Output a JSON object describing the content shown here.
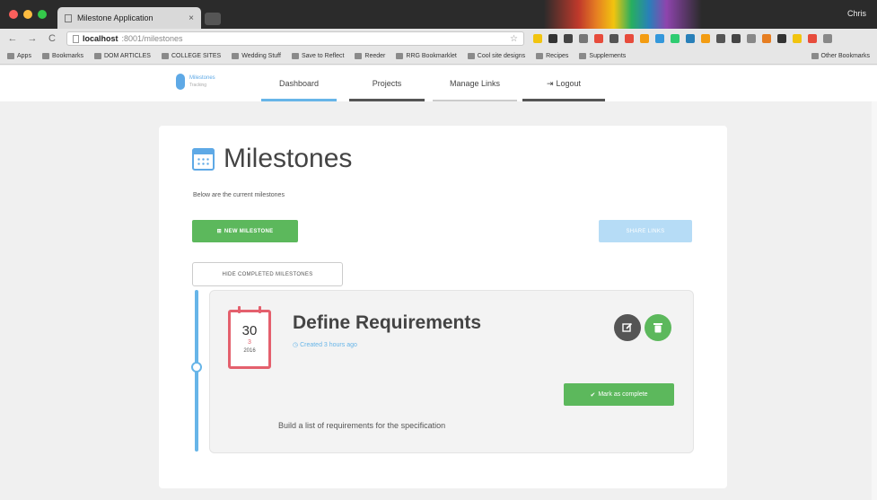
{
  "browser": {
    "tab_title": "Milestone Application",
    "tab_close": "×",
    "user_name": "Chris",
    "nav_back": "←",
    "nav_forward": "→",
    "nav_reload": "C",
    "url_host": "localhost",
    "url_path": ":8001/milestones",
    "star": "☆",
    "extensions_colors": [
      "#f1c40f",
      "#333333",
      "#444444",
      "#777777",
      "#e74c3c",
      "#555555",
      "#e74c3c",
      "#f39c12",
      "#3498db",
      "#2ecc71",
      "#2980b9",
      "#f39c12",
      "#555555",
      "#444444",
      "#888888",
      "#e67e22",
      "#333333",
      "#f1c40f",
      "#e74c3c",
      "#888888"
    ],
    "bookmarks": [
      "Apps",
      "Bookmarks",
      "DOM ARTICLES",
      "COLLEGE SITES",
      "Wedding Stuff",
      "Save to Reflect",
      "Reeder",
      "RRG Bookmarklet",
      "Cool site designs",
      "Recipes",
      "Supplements"
    ],
    "bookmarks_right": "Other Bookmarks"
  },
  "app_nav": {
    "brand_name": "Milestones",
    "brand_sub": "Tracking",
    "items": [
      "Dashboard",
      "Projects",
      "Manage Links",
      "Logout"
    ],
    "logout_icon": "⇥"
  },
  "page": {
    "title": "Milestones",
    "subtitle": "Below are the current milestones",
    "new_milestone_label": "NEW MILESTONE",
    "new_milestone_icon": "⊞",
    "secondary_label": "SHARE LINKS",
    "hide_completed_label": "HIDE COMPLETED MILESTONES"
  },
  "milestone": {
    "day": "30",
    "month": "3",
    "year": "2016",
    "title": "Define Requirements",
    "created": "Created 3 hours ago",
    "created_icon": "◷",
    "mark_complete_label": "Mark as complete",
    "check_icon": "✔",
    "description": "Build a list of requirements for the specification"
  }
}
